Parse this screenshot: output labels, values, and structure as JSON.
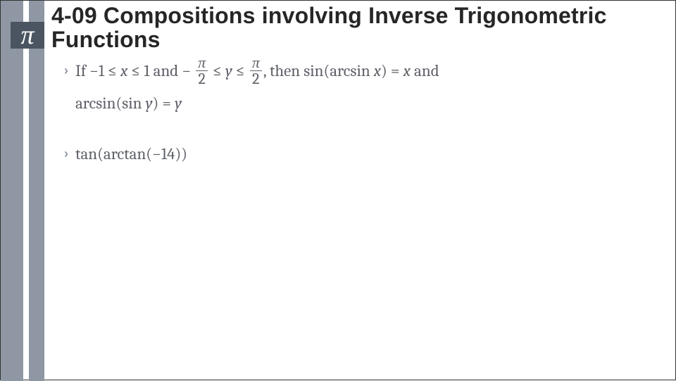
{
  "decor": {
    "pi_glyph": "π"
  },
  "title": {
    "text": "4-09 Compositions involving Inverse Trigonometric Functions"
  },
  "bullets": [
    {
      "prefix": "If",
      "cond_x_low": "−1",
      "cond_x_rel1": "≤",
      "cond_x_var": "x",
      "cond_x_rel2": "≤",
      "cond_x_high": "1",
      "and1": "and",
      "neg": "−",
      "frac1_num": "π",
      "frac1_den": "2",
      "cond_y_rel1": "≤",
      "cond_y_var": "y",
      "cond_y_rel2": "≤",
      "frac2_num": "π",
      "frac2_den": "2",
      "comma_then": ", then",
      "sin": "sin",
      "arcsin": "arcsin",
      "eq": "=",
      "and2": "and",
      "second_lhs_func": "arcsin",
      "second_inner_func": "sin",
      "second_var": "y"
    },
    {
      "tan": "tan",
      "arctan": "arctan",
      "value": "−14"
    }
  ]
}
